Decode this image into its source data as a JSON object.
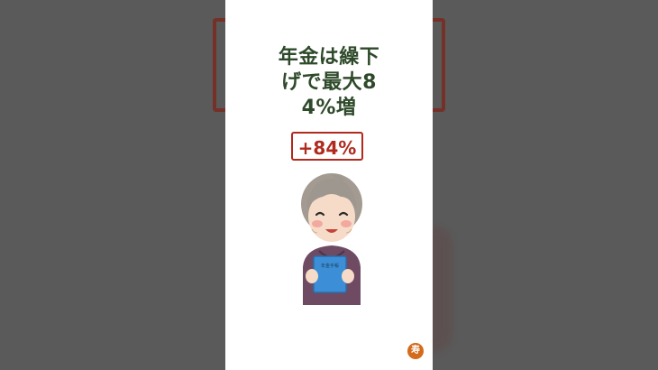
{
  "short": {
    "headline_lines": [
      "年金は繰下",
      "げで最大8",
      "4%増"
    ],
    "badge": "+84%",
    "channel_icon_text": "寿",
    "booklet_text": "年金手帳"
  },
  "colors": {
    "headline": "#2e4a2a",
    "badge": "#b02a1e",
    "channel_icon_bg": "#d46a1b"
  }
}
